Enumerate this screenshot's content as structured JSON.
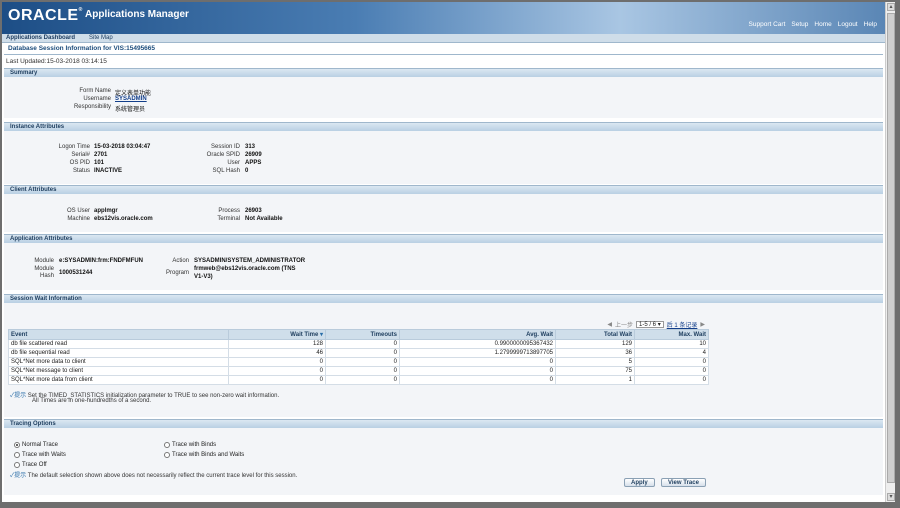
{
  "brand": {
    "logo": "ORACLE",
    "app_title": "Applications Manager"
  },
  "global_links": [
    "Support Cart",
    "Setup",
    "Home",
    "Logout",
    "Help"
  ],
  "tabs": [
    "Applications Dashboard",
    "Site Map"
  ],
  "page": {
    "title": "Database Session Information for VIS:15495665",
    "updated": "Last Updated:15-03-2018 03:14:15"
  },
  "summary": {
    "header": "Summary",
    "form_name_label": "Form Name",
    "form_name": "定义表单功能",
    "username_label": "Username",
    "username": "SYSADMIN",
    "responsibility_label": "Responsibility",
    "responsibility": "系统管理员"
  },
  "instance": {
    "header": "Instance Attributes",
    "logon_time_label": "Logon Time",
    "logon_time": "15-03-2018 03:04:47",
    "serial_label": "Serial#",
    "serial": "2701",
    "os_pid_label": "OS PID",
    "os_pid": "101",
    "status_label": "Status",
    "status": "INACTIVE",
    "session_id_label": "Session ID",
    "session_id": "313",
    "oracle_spid_label": "Oracle SPID",
    "oracle_spid": "26909",
    "user_label": "User",
    "user": "APPS",
    "sql_hash_label": "SQL Hash",
    "sql_hash": "0"
  },
  "client": {
    "header": "Client Attributes",
    "os_user_label": "OS User",
    "os_user": "applmgr",
    "machine_label": "Machine",
    "machine": "ebs12vis.oracle.com",
    "process_label": "Process",
    "process": "26903",
    "terminal_label": "Terminal",
    "terminal": "Not Available"
  },
  "application": {
    "header": "Application Attributes",
    "module_label": "Module",
    "module": "e:SYSADMIN:frm:FNDFMFUN",
    "module_hash_label_1": "Module",
    "module_hash_label_2": "Hash",
    "module_hash": "1000531244",
    "action_label": "Action",
    "action": "SYSADMIN/SYSTEM_ADMINISTRATOR",
    "program_label": "Program",
    "program_1": "frmweb@ebs12vis.oracle.com (TNS",
    "program_2": "V1-V3)"
  },
  "wait": {
    "header": "Session Wait Information",
    "pager": {
      "prev": "上一步",
      "range": "1-5 / 6",
      "next": "后 1 条记录"
    },
    "columns": [
      "Event",
      "Wait Time",
      "Timeouts",
      "Avg. Wait",
      "Total Wait",
      "Max. Wait"
    ],
    "sort_glyph": "▾",
    "rows": [
      [
        "db file scattered read",
        "128",
        "0",
        "0.9900000095367432",
        "129",
        "10"
      ],
      [
        "db file sequential read",
        "46",
        "0",
        "1.2799999713897705",
        "36",
        "4"
      ],
      [
        "SQL*Net more data to client",
        "0",
        "0",
        "0",
        "5",
        "0"
      ],
      [
        "SQL*Net message to client",
        "0",
        "0",
        "0",
        "75",
        "0"
      ],
      [
        "SQL*Net more data from client",
        "0",
        "0",
        "0",
        "1",
        "0"
      ]
    ],
    "tip_label": "提示",
    "tip_text": "Set the TIMED_STATISTICS initialization parameter to TRUE to see non-zero wait information.",
    "tip_text_2": "All Times are in one-hundredths of a second."
  },
  "tracing": {
    "header": "Tracing Options",
    "options": [
      "Normal Trace",
      "Trace with Waits",
      "Trace Off",
      "Trace with Binds",
      "Trace with Binds and Waits"
    ],
    "selected": "Normal Trace",
    "tip_label": "提示",
    "tip_text": "The default selection shown above does not necessarily reflect the current trace level for this session.",
    "apply": "Apply",
    "view_trace": "View Trace"
  }
}
